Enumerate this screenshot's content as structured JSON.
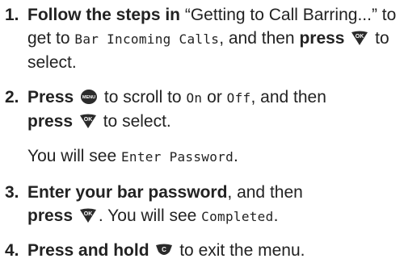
{
  "steps": [
    {
      "number": "1.",
      "b1": "Follow the steps in",
      "t1": " “Getting to Call Barring...” to get to ",
      "lcd1": "Bar Incoming Calls",
      "t2": ", and then ",
      "b2": "press",
      "t3": " to select."
    },
    {
      "number": "2.",
      "b1": "Press",
      "t1": " to scroll to ",
      "lcd1": "On",
      "t2": " or ",
      "lcd2": "Off",
      "t3": ", and then ",
      "b2": "press",
      "t4": " to select.",
      "note_pre": "You will see ",
      "note_lcd": "Enter Password",
      "note_post": "."
    },
    {
      "number": "3.",
      "b1": "Enter your bar password",
      "t1": ", and then ",
      "b2": "press",
      "t2": ". You will see ",
      "lcd1": "Completed",
      "t3": "."
    },
    {
      "number": "4.",
      "b1": "Press and hold",
      "t1": " to exit the menu."
    }
  ],
  "keys": {
    "ok": "OK",
    "menu": "MENU",
    "clear": "C"
  },
  "icons": {
    "ok": "ok-key-icon",
    "menu": "menu-key-icon",
    "clear": "clear-key-icon"
  }
}
